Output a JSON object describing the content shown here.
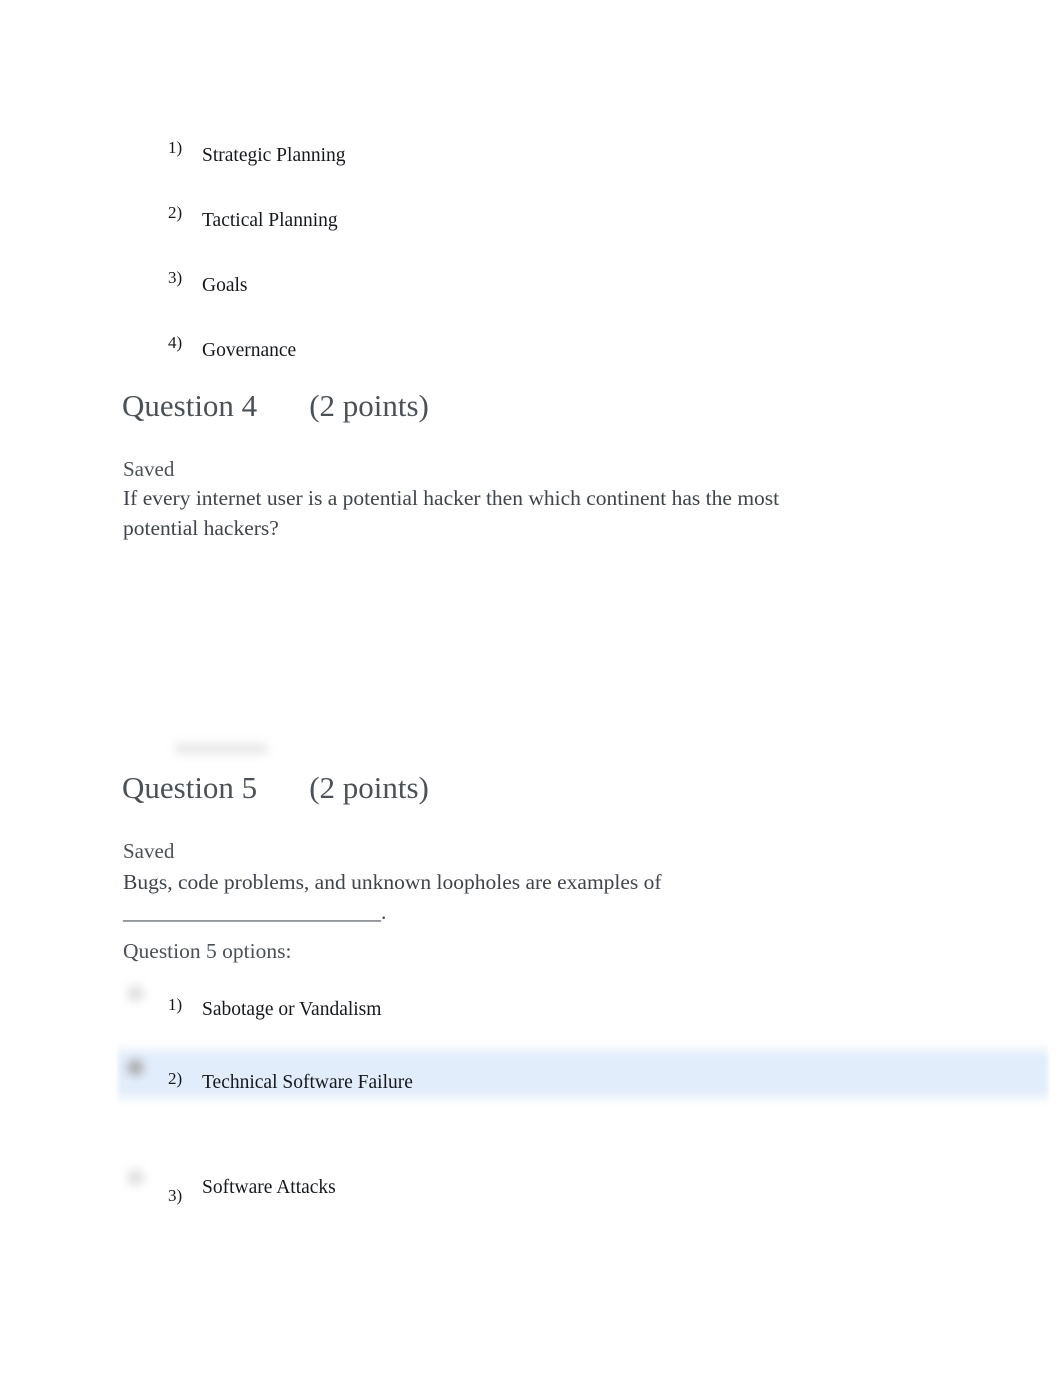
{
  "document": {
    "background_color": "#ffffff",
    "text_color": "#3f454b",
    "highlight_color": "#e2edfb"
  },
  "carried_options": {
    "items": [
      {
        "marker": "1)",
        "label": "Strategic Planning"
      },
      {
        "marker": "2)",
        "label": "Tactical Planning"
      },
      {
        "marker": "3)",
        "label": "Goals"
      },
      {
        "marker": "4)",
        "label": "Governance"
      }
    ]
  },
  "question4": {
    "heading": "Question 4",
    "points": "(2 points)",
    "status": "Saved",
    "prompt": "If every internet user is a potential hacker then which continent has the most potential hackers?"
  },
  "question5": {
    "heading": "Question 5",
    "points": "(2 points)",
    "status": "Saved",
    "prompt": "Bugs, code problems, and unknown loopholes are examples of ________________________.",
    "options_label": "Question 5 options:",
    "options": [
      {
        "marker": "1)",
        "label": "Sabotage or Vandalism",
        "selected": false
      },
      {
        "marker": "2)",
        "label": "Technical Software Failure",
        "selected": true
      },
      {
        "marker": "3)",
        "label": "Software Attacks",
        "selected": false
      }
    ]
  }
}
